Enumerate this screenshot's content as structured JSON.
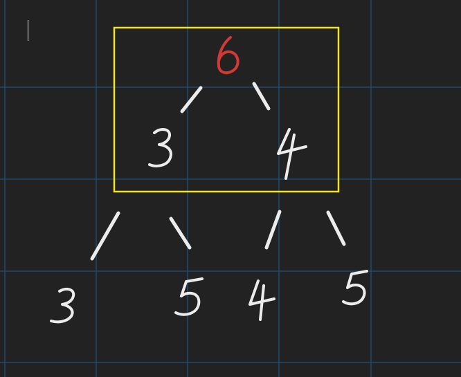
{
  "canvas": {
    "background": "#222222",
    "grid_color": "#1d4a6e",
    "ink_color": "#ececec",
    "highlight_color": "#d33a36",
    "box_color": "#f2e51f"
  },
  "tree": {
    "root": {
      "label": "6"
    },
    "level1": [
      {
        "label": "3"
      },
      {
        "label": "4"
      }
    ],
    "level2": [
      {
        "label": "3"
      },
      {
        "label": "5"
      },
      {
        "label": "4"
      },
      {
        "label": "5"
      }
    ]
  }
}
